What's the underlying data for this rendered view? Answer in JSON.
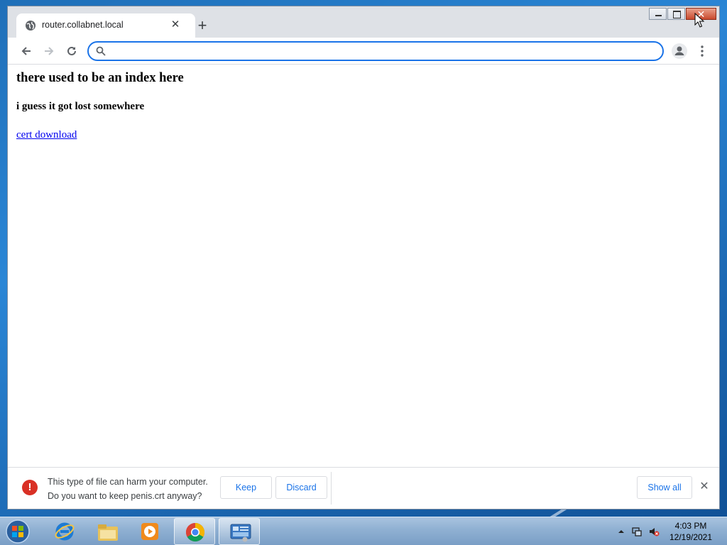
{
  "browser": {
    "tab": {
      "title": "router.collabnet.local"
    },
    "omnibox": {
      "value": "",
      "placeholder": ""
    }
  },
  "page": {
    "heading": "there used to be an index here",
    "subheading": "i guess it got lost somewhere",
    "link_text": "cert download"
  },
  "download_bar": {
    "warning_line1": "This type of file can harm your computer.",
    "warning_line2": "Do you want to keep penis.crt anyway?",
    "keep_label": "Keep",
    "discard_label": "Discard",
    "show_all_label": "Show all"
  },
  "taskbar": {
    "items": [
      "internet-explorer",
      "file-explorer",
      "media-player",
      "chrome",
      "control-panel"
    ],
    "active_item": "control-panel",
    "clock": {
      "time": "4:03 PM",
      "date": "12/19/2021"
    }
  },
  "colors": {
    "accent": "#1a73e8",
    "warning": "#d93025",
    "link": "#0000ee",
    "close_button": "#c94a2f"
  }
}
